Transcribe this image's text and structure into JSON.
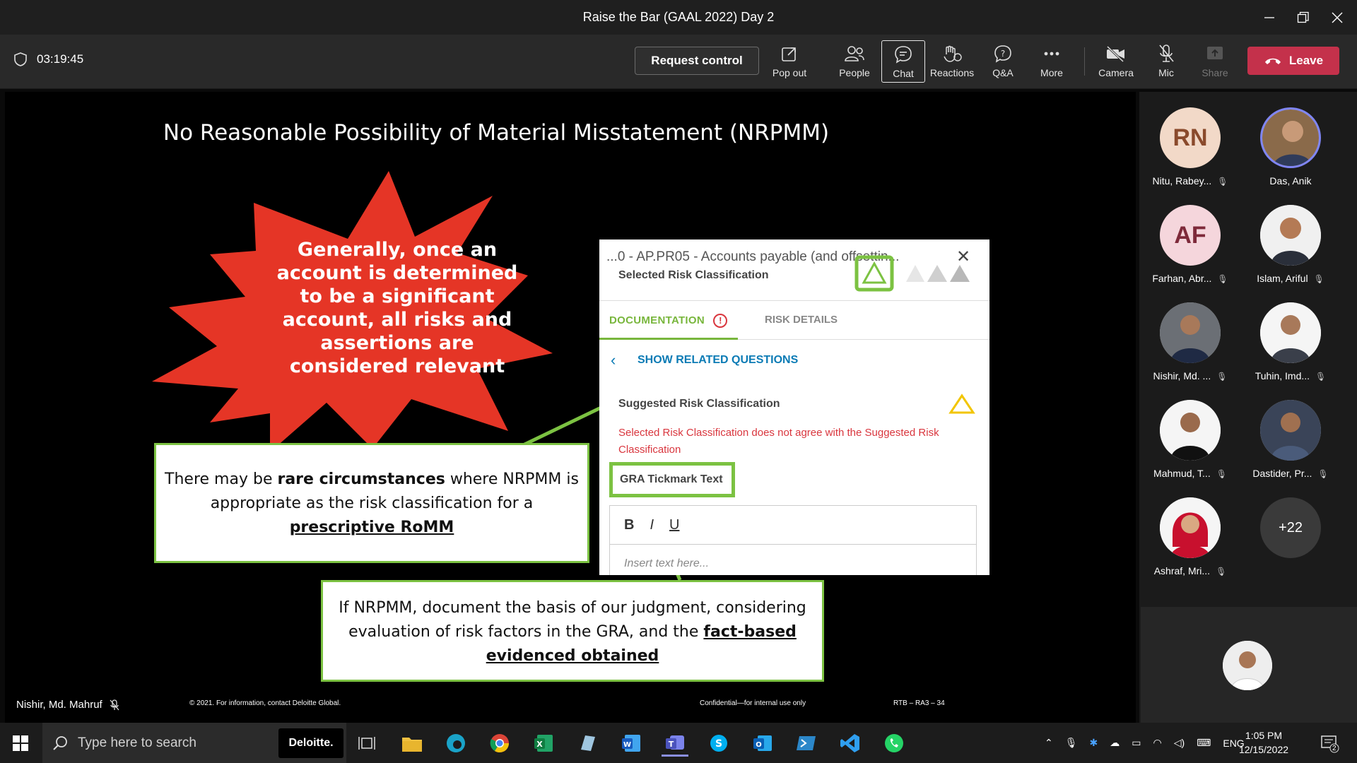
{
  "window": {
    "title": "Raise the Bar (GAAL 2022) Day 2"
  },
  "toolbar": {
    "timer": "03:19:45",
    "request_control": "Request control",
    "items": [
      {
        "label": "Pop out",
        "icon": "pop-out-icon"
      },
      {
        "label": "People",
        "icon": "people-icon"
      },
      {
        "label": "Chat",
        "icon": "chat-icon",
        "active": true
      },
      {
        "label": "Reactions",
        "icon": "reactions-icon"
      },
      {
        "label": "Q&A",
        "icon": "qa-icon"
      },
      {
        "label": "More",
        "icon": "more-icon"
      },
      {
        "label": "Camera",
        "icon": "camera-off-icon"
      },
      {
        "label": "Mic",
        "icon": "mic-off-icon"
      },
      {
        "label": "Share",
        "icon": "share-icon",
        "disabled": true
      }
    ],
    "leave": "Leave"
  },
  "slide": {
    "title": "No Reasonable Possibility of Material Misstatement (NRPMM)",
    "burst_text": "Generally, once an account is determined to be a significant account, all risks and assertions are considered relevant",
    "box1": {
      "p1": "There may be ",
      "p2": "rare circumstances",
      "p3": " where NRPMM is appropriate as the risk classification for a ",
      "p4": "prescriptive RoMM"
    },
    "box2": {
      "p1": "If NRPMM, document the basis of our judgment, considering evaluation of risk factors in the GRA, and the ",
      "p2": "fact-based evidenced obtained"
    },
    "panel": {
      "title": "...0 - AP.PR05 - Accounts payable (and offsettin...",
      "selected_label": "Selected Risk Classification",
      "tab_doc": "DOCUMENTATION",
      "tab_risk": "RISK DETAILS",
      "show_related": "SHOW RELATED QUESTIONS",
      "suggested_label": "Suggested Risk Classification",
      "warning": "Selected Risk Classification does not agree with the Suggested Risk Classification",
      "gra_label": "GRA Tickmark Text",
      "editor_placeholder": "Insert text here...",
      "fmt_bold": "B",
      "fmt_italic": "I",
      "fmt_underline": "U"
    },
    "footer_left": "© 2021. For information, contact Deloitte Global.",
    "footer_mid": "Confidential—for internal use only",
    "footer_right": "RTB – RA3 – 34",
    "presenter": "Nishir, Md. Mahruf"
  },
  "participants": [
    {
      "name": "Nitu, Rabey...",
      "initials": "RN",
      "muted": true
    },
    {
      "name": "Das, Anik",
      "muted": false
    },
    {
      "name": "Farhan, Abr...",
      "initials": "AF",
      "muted": true
    },
    {
      "name": "Islam, Ariful",
      "muted": true
    },
    {
      "name": "Nishir, Md. ...",
      "muted": true
    },
    {
      "name": "Tuhin, Imd...",
      "muted": true
    },
    {
      "name": "Mahmud, T...",
      "muted": true
    },
    {
      "name": "Dastider, Pr...",
      "muted": true
    },
    {
      "name": "Ashraf, Mri...",
      "muted": true
    },
    {
      "name": "",
      "overflow": "+22"
    }
  ],
  "taskbar": {
    "search_placeholder": "Type here to search",
    "deloitte": "Deloitte.",
    "lang": "ENG",
    "time": "1:05 PM",
    "date": "12/15/2022",
    "notif_count": "2"
  },
  "colors": {
    "leave": "#c4314b",
    "burst": "#e53526",
    "callout_green": "#7cc242",
    "warning_red": "#d9363e",
    "link_blue": "#0b7bb5"
  }
}
